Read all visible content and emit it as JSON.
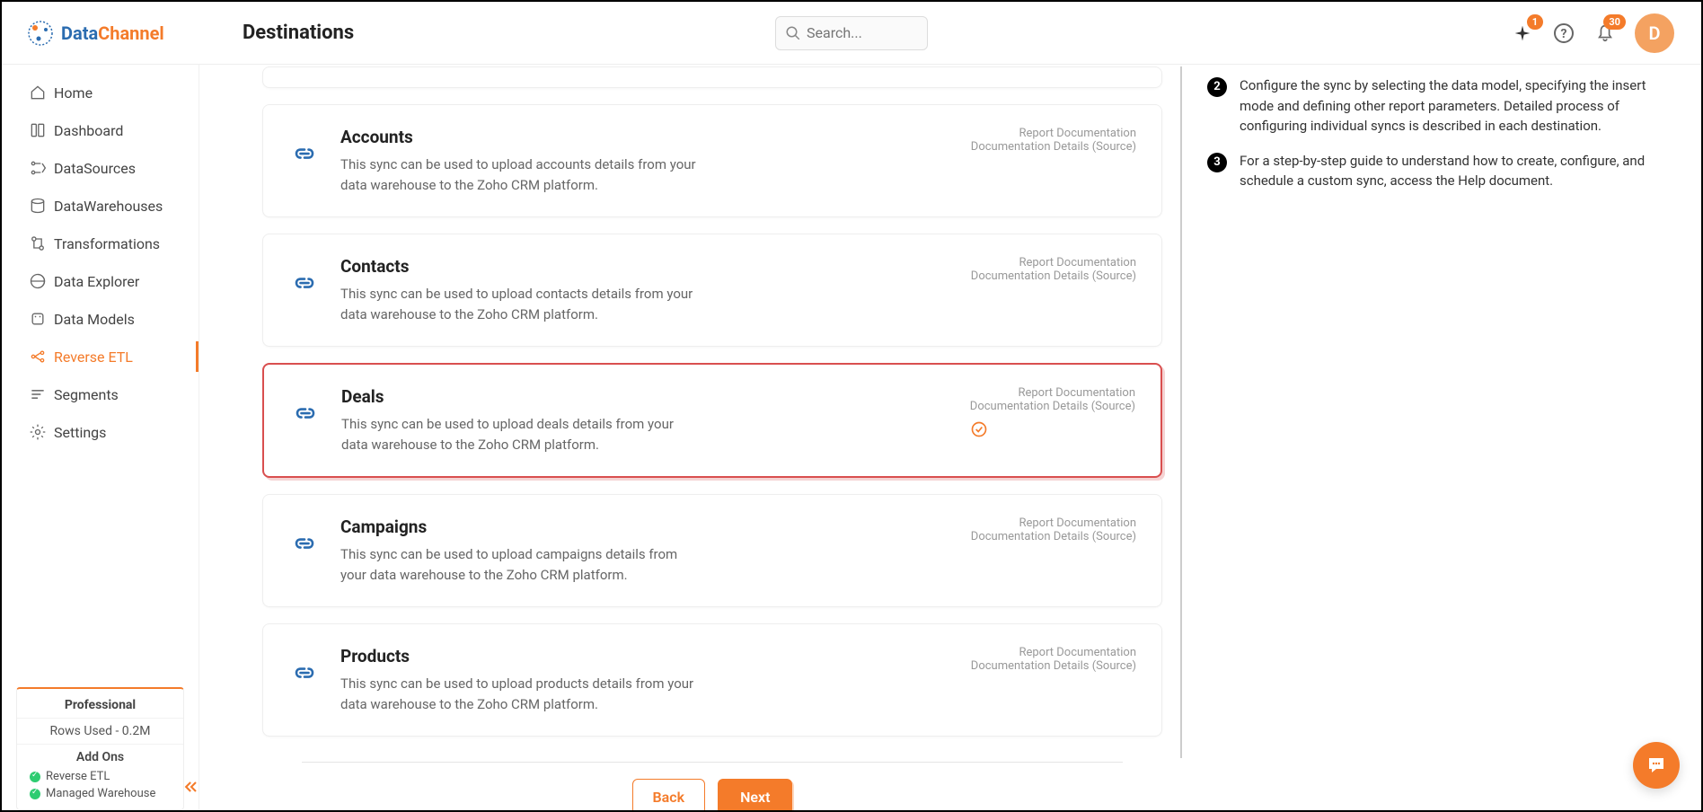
{
  "header": {
    "logo_part1": "Data",
    "logo_part2": "Channel",
    "page_title": "Destinations",
    "search_placeholder": "Search...",
    "sparkle_badge": "1",
    "bell_badge": "30",
    "avatar_initial": "D"
  },
  "sidebar": {
    "items": [
      {
        "label": "Home",
        "icon": "home-icon"
      },
      {
        "label": "Dashboard",
        "icon": "dashboard-icon"
      },
      {
        "label": "DataSources",
        "icon": "datasources-icon"
      },
      {
        "label": "DataWarehouses",
        "icon": "datawarehouses-icon"
      },
      {
        "label": "Transformations",
        "icon": "transformations-icon"
      },
      {
        "label": "Data Explorer",
        "icon": "data-explorer-icon"
      },
      {
        "label": "Data Models",
        "icon": "data-models-icon"
      },
      {
        "label": "Reverse ETL",
        "icon": "reverse-etl-icon"
      },
      {
        "label": "Segments",
        "icon": "segments-icon"
      },
      {
        "label": "Settings",
        "icon": "settings-icon"
      }
    ],
    "active_index": 7,
    "plan": {
      "name": "Professional",
      "rows_used": "Rows Used - 0.2M",
      "addons_title": "Add Ons",
      "addons": [
        "Reverse ETL",
        "Managed Warehouse"
      ]
    }
  },
  "syncs": [
    {
      "title": "Accounts",
      "desc": "This sync can be used to upload accounts details from your data warehouse to the Zoho CRM platform.",
      "link1": "Report Documentation",
      "link2": "Documentation Details (Source)",
      "selected": false
    },
    {
      "title": "Contacts",
      "desc": "This sync can be used to upload contacts details from your data warehouse to the Zoho CRM platform.",
      "link1": "Report Documentation",
      "link2": "Documentation Details (Source)",
      "selected": false
    },
    {
      "title": "Deals",
      "desc": "This sync can be used to upload deals details from your data warehouse to the Zoho CRM platform.",
      "link1": "Report Documentation",
      "link2": "Documentation Details (Source)",
      "selected": true
    },
    {
      "title": "Campaigns",
      "desc": "This sync can be used to upload campaigns details from your data warehouse to the Zoho CRM platform.",
      "link1": "Report Documentation",
      "link2": "Documentation Details (Source)",
      "selected": false
    },
    {
      "title": "Products",
      "desc": "This sync can be used to upload products details from your data warehouse to the Zoho CRM platform.",
      "link1": "Report Documentation",
      "link2": "Documentation Details (Source)",
      "selected": false
    }
  ],
  "buttons": {
    "back": "Back",
    "next": "Next"
  },
  "steps": [
    {
      "num": "2",
      "text": "Configure the sync by selecting the data model, specifying the insert mode and defining other report parameters. Detailed process of configuring individual syncs is described in each destination."
    },
    {
      "num": "3",
      "text": "For a step-by-step guide to understand how to create, configure, and schedule a custom sync, access the Help document."
    }
  ]
}
